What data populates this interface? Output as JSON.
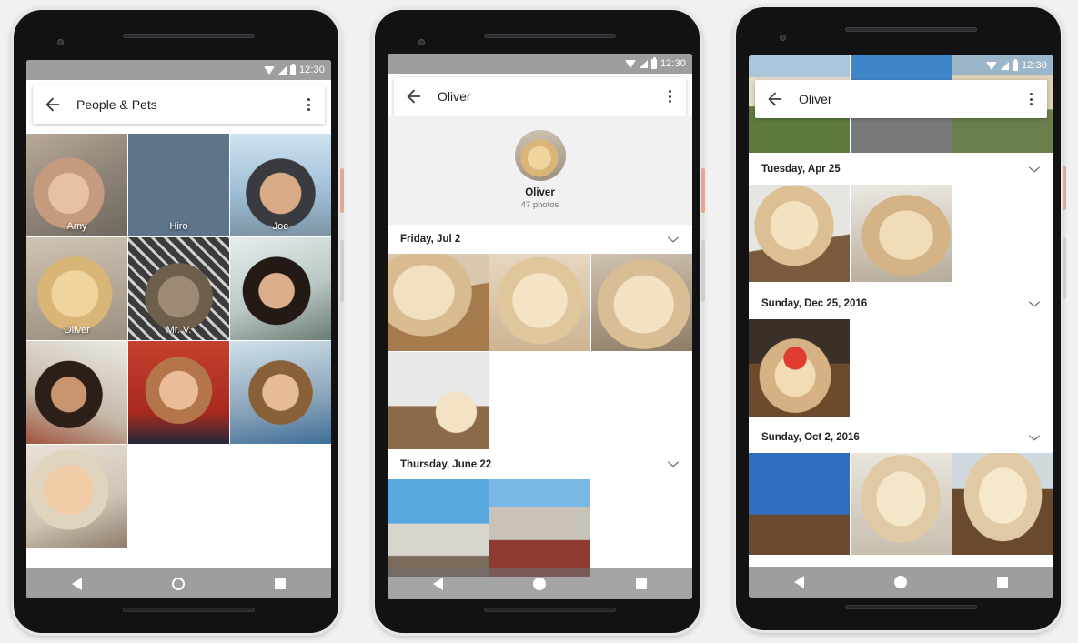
{
  "background_color": "#f1f1f1",
  "accent_colors": {
    "status_bar": "#9e9e9e",
    "nav_bar": "#9e9e9e",
    "app_bar": "#ffffff",
    "power_button": "#e4a794",
    "volume_button": "#cfcfcf",
    "text_primary": "#202124",
    "text_secondary": "#70757a"
  },
  "status_bar": {
    "time": "12:30",
    "icons": [
      "wifi-icon",
      "signal-icon",
      "battery-icon"
    ]
  },
  "nav_bar": {
    "items": [
      {
        "name": "back-nav-button",
        "icon": "triangle-back-icon"
      },
      {
        "name": "home-nav-button",
        "icon": "circle-home-icon"
      },
      {
        "name": "recents-nav-button",
        "icon": "square-recents-icon"
      }
    ]
  },
  "phones": [
    {
      "id": "phone-people-and-pets",
      "app_bar": {
        "title": "People & Pets",
        "back_icon": "arrow-back-icon",
        "more_icon": "overflow-menu-icon"
      },
      "grid_rows": [
        [
          {
            "label": "Amy",
            "style": "p-amy"
          },
          {
            "label": "Hiro",
            "style": "p-hiro"
          },
          {
            "label": "Joe",
            "style": "p-joe"
          }
        ],
        [
          {
            "label": "Oliver",
            "style": "p-oliver"
          },
          {
            "label": "Mr. V.",
            "style": "p-mrv"
          },
          {
            "label": "",
            "style": "p-man"
          }
        ],
        [
          {
            "label": "",
            "style": "p-woman2"
          },
          {
            "label": "",
            "style": "p-toddler"
          },
          {
            "label": "",
            "style": "p-boy"
          }
        ],
        [
          {
            "label": "",
            "style": "p-girl"
          }
        ]
      ]
    },
    {
      "id": "phone-oliver-profile",
      "app_bar": {
        "title": "Oliver",
        "back_icon": "arrow-back-icon",
        "more_icon": "overflow-menu-icon"
      },
      "profile": {
        "name": "Oliver",
        "photo_count": "47 photos",
        "avatar_icon": "oliver-avatar"
      },
      "sections": [
        {
          "date": "Friday, Jul 2",
          "chevron": "chevron-down-icon",
          "rows": [
            [
              {
                "style": "dog-lying"
              },
              {
                "style": "dog-face"
              },
              {
                "style": "dog-glass"
              }
            ],
            [
              {
                "style": "dog-party"
              }
            ]
          ]
        },
        {
          "date": "Thursday, June 22",
          "chevron": "chevron-down-icon",
          "rows": [
            [
              {
                "style": "dog-clock"
              },
              {
                "style": "dog-street"
              }
            ]
          ]
        }
      ]
    },
    {
      "id": "phone-oliver-scrolled",
      "app_bar": {
        "title": "Oliver",
        "back_icon": "arrow-back-icon",
        "more_icon": "overflow-menu-icon"
      },
      "top_row": [
        {
          "style": "dog-grass1"
        },
        {
          "style": "dog-grass2"
        },
        {
          "style": "dog-grass3"
        }
      ],
      "sections": [
        {
          "date": "Tuesday, Apr 25",
          "chevron": "chevron-down-icon",
          "rows": [
            [
              {
                "style": "dog-bow"
              },
              {
                "style": "dog-look"
              }
            ]
          ]
        },
        {
          "date": "Sunday, Dec 25, 2016",
          "chevron": "chevron-down-icon",
          "rows": [
            [
              {
                "style": "dog-santa"
              }
            ]
          ]
        },
        {
          "date": "Sunday, Oct 2, 2016",
          "chevron": "chevron-down-icon",
          "rows": [
            [
              {
                "style": "dog-cert"
              },
              {
                "style": "pup-floor"
              },
              {
                "style": "pup-dark"
              }
            ]
          ]
        }
      ]
    }
  ]
}
